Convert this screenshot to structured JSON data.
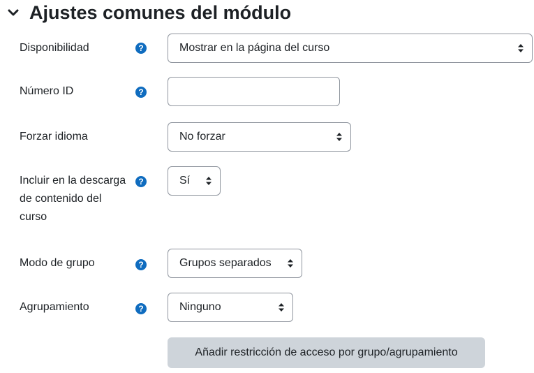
{
  "section": {
    "title": "Ajustes comunes del módulo",
    "expanded": true
  },
  "fields": {
    "availability": {
      "label": "Disponibilidad",
      "value": "Mostrar en la página del curso"
    },
    "idnumber": {
      "label": "Número ID",
      "value": ""
    },
    "force_language": {
      "label": "Forzar idioma",
      "value": "No forzar"
    },
    "download_content": {
      "label": "Incluir en la descarga de contenido del curso",
      "value": "Sí"
    },
    "group_mode": {
      "label": "Modo de grupo",
      "value": "Grupos separados"
    },
    "grouping": {
      "label": "Agrupamiento",
      "value": "Ninguno"
    }
  },
  "actions": {
    "add_restriction": "Añadir restricción de acceso por grupo/agrupamiento"
  },
  "colors": {
    "accent": "#0f6cbf",
    "button_bg": "#ced4da",
    "border": "#8f959e"
  },
  "icons": {
    "help": "question-circle-icon",
    "collapse": "chevron-down-icon",
    "select": "sort-arrows-icon"
  }
}
